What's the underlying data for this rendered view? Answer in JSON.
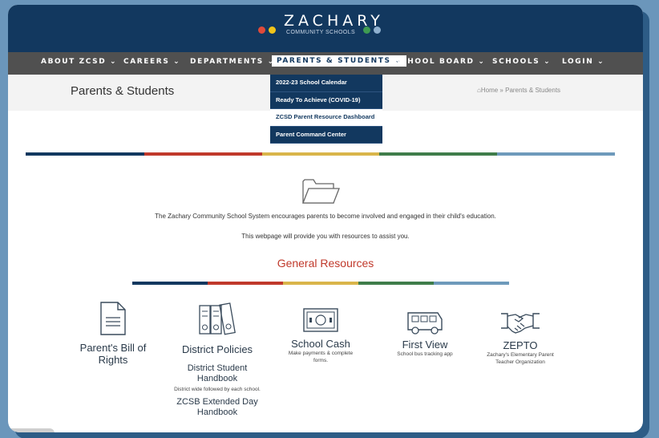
{
  "logo": {
    "name": "ZACHARY",
    "subtitle": "COMMUNITY SCHOOLS",
    "dot_colors": [
      "#e04a3a",
      "#f0c419",
      "#3f9b52",
      "#8fb0cf"
    ]
  },
  "nav": {
    "items": [
      {
        "label": "ABOUT ZCSD ⌄"
      },
      {
        "label": "CAREERS ⌄"
      },
      {
        "label": "DEPARTMENTS ⌄"
      },
      {
        "label": "PARENTS & STUDENTS ⌄"
      },
      {
        "label": "SCHOOL BOARD ⌄"
      },
      {
        "label": "SCHOOLS ⌄"
      },
      {
        "label": "LOGIN ⌄"
      }
    ]
  },
  "dropdown": {
    "items": [
      {
        "label": "2022-23 School Calendar"
      },
      {
        "label": "Ready To Achieve (COVID-19)"
      },
      {
        "label": "ZCSD Parent Resource Dashboard"
      },
      {
        "label": "Parent Command Center"
      }
    ]
  },
  "titlebar": {
    "title": "Parents & Students",
    "breadcrumb_home": "Home",
    "breadcrumb_sep": "»",
    "breadcrumb_current": "Parents & Students"
  },
  "stripe_colors": [
    "#12385f",
    "#c0392b",
    "#d9b54a",
    "#3f7d4a",
    "#6e9abb"
  ],
  "intro": {
    "line1": "The Zachary Community School System encourages parents to become involved and engaged in their child's education.",
    "line2": "This webpage will provide you with resources to assist you."
  },
  "section": {
    "title": "General Resources"
  },
  "resources": [
    {
      "title": "Parent's Bill of Rights",
      "icon": "document-icon"
    },
    {
      "title": "District Policies",
      "icon": "binders-icon",
      "links": [
        {
          "title": "District Student Handbook",
          "sub": "District wide followed by each school."
        },
        {
          "title": "ZCSB Extended Day Handbook"
        }
      ]
    },
    {
      "title": "School Cash",
      "sub": "Make payments & complete forms.",
      "icon": "cash-icon"
    },
    {
      "title": "First View",
      "sub": "School bus tracking app",
      "icon": "bus-icon"
    },
    {
      "title": "ZEPTO",
      "sub": "Zachary's Elementary Parent Teacher Organization",
      "icon": "handshake-icon"
    }
  ]
}
